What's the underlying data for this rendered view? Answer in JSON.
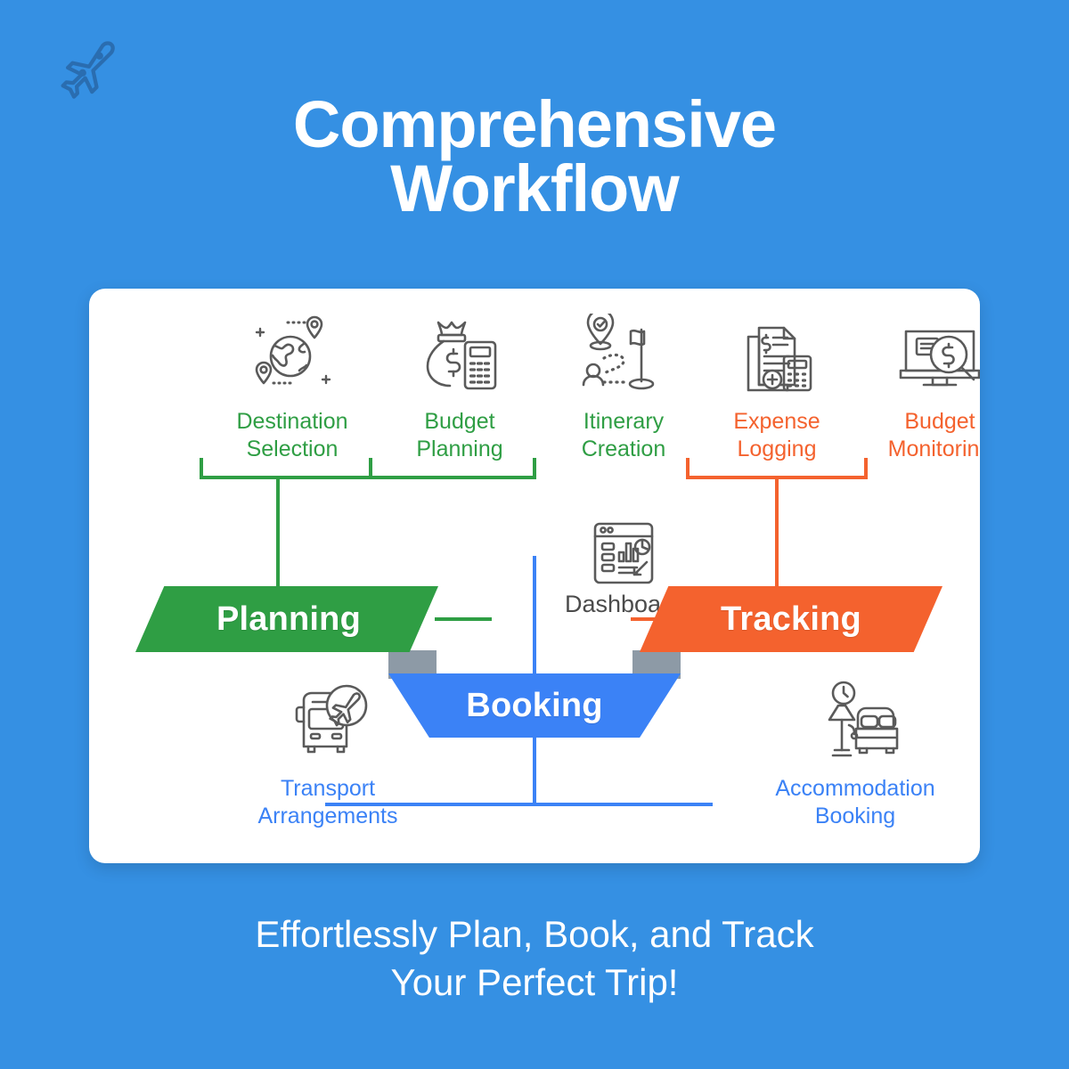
{
  "theme": {
    "background": "#3590e3",
    "card_background": "#ffffff",
    "green": "#2f9e44",
    "orange": "#f4622e",
    "blue": "#3b82f6",
    "gray_icon": "#5a5a5a",
    "gray_tab": "#8d9aa6",
    "white": "#ffffff"
  },
  "logo": {
    "icon": "airplane-icon"
  },
  "header": {
    "title_line1": "Comprehensive",
    "title_line2": "Workflow"
  },
  "diagram": {
    "planning": {
      "banner_label": "Planning",
      "color": "#2f9e44",
      "items": [
        {
          "label": "Destination\nSelection",
          "icon": "globe-location-pins-icon"
        },
        {
          "label": "Budget\nPlanning",
          "icon": "money-bag-calculator-icon"
        },
        {
          "label": "Itinerary\nCreation",
          "icon": "route-flag-icon"
        }
      ]
    },
    "tracking": {
      "banner_label": "Tracking",
      "color": "#f4622e",
      "items": [
        {
          "label": "Expense\nLogging",
          "icon": "receipt-calculator-icon"
        },
        {
          "label": "Budget\nMonitoring",
          "icon": "monitor-magnifier-dollar-icon"
        }
      ]
    },
    "booking": {
      "banner_label": "Booking",
      "color": "#3b82f6",
      "items": [
        {
          "label": "Transport\nArrangements",
          "icon": "bus-plane-icon"
        },
        {
          "label": "Accommodation\nBooking",
          "icon": "bed-lamp-clock-icon"
        }
      ]
    },
    "dashboard": {
      "label": "Dashboard",
      "icon": "dashboard-window-icon"
    }
  },
  "footer": {
    "caption": "Effortlessly Plan, Book, and Track\nYour Perfect Trip!"
  }
}
